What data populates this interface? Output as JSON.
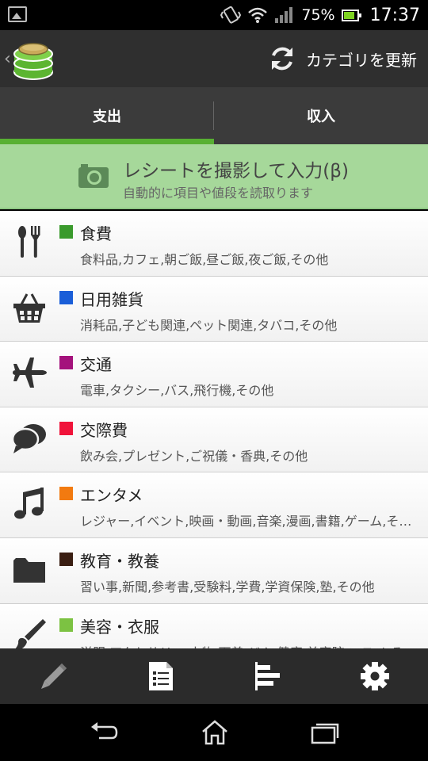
{
  "status_bar": {
    "battery_percent": "75%",
    "time": "17:37"
  },
  "action_bar": {
    "refresh_label": "カテゴリを更新"
  },
  "tabs": [
    {
      "label": "支出",
      "active": true
    },
    {
      "label": "収入",
      "active": false
    }
  ],
  "receipt_banner": {
    "title": "レシートを撮影して入力(β)",
    "subtitle": "自動的に項目や値段を読取ります"
  },
  "categories": [
    {
      "name": "食費",
      "items": "食料品,カフェ,朝ご飯,昼ご飯,夜ご飯,その他",
      "color": "#3a9a2c",
      "icon": "utensils-icon"
    },
    {
      "name": "日用雑貨",
      "items": "消耗品,子ども関連,ペット関連,タバコ,その他",
      "color": "#1a5ed8",
      "icon": "basket-icon"
    },
    {
      "name": "交通",
      "items": "電車,タクシー,バス,飛行機,その他",
      "color": "#a4127c",
      "icon": "airplane-icon"
    },
    {
      "name": "交際費",
      "items": "飲み会,プレゼント,ご祝儀・香典,その他",
      "color": "#f0133a",
      "icon": "chat-bubbles-icon"
    },
    {
      "name": "エンタメ",
      "items": "レジャー,イベント,映画・動画,音楽,漫画,書籍,ゲーム,その他",
      "color": "#f27a10",
      "icon": "music-note-icon"
    },
    {
      "name": "教育・教養",
      "items": "習い事,新聞,参考書,受験料,学費,学資保険,塾,その他",
      "color": "#3a1e12",
      "icon": "folder-icon"
    },
    {
      "name": "美容・衣服",
      "items": "洋服,アクセサリー,小物,下着,ジム,健康,美容院,コスメ,その他",
      "color": "#7cc242",
      "icon": "brush-icon"
    }
  ],
  "toolbar": [
    {
      "icon": "pen-icon"
    },
    {
      "icon": "list-icon"
    },
    {
      "icon": "bar-chart-icon"
    },
    {
      "icon": "gear-icon"
    }
  ],
  "nav": [
    {
      "icon": "back-icon"
    },
    {
      "icon": "home-icon"
    },
    {
      "icon": "recent-apps-icon"
    }
  ]
}
